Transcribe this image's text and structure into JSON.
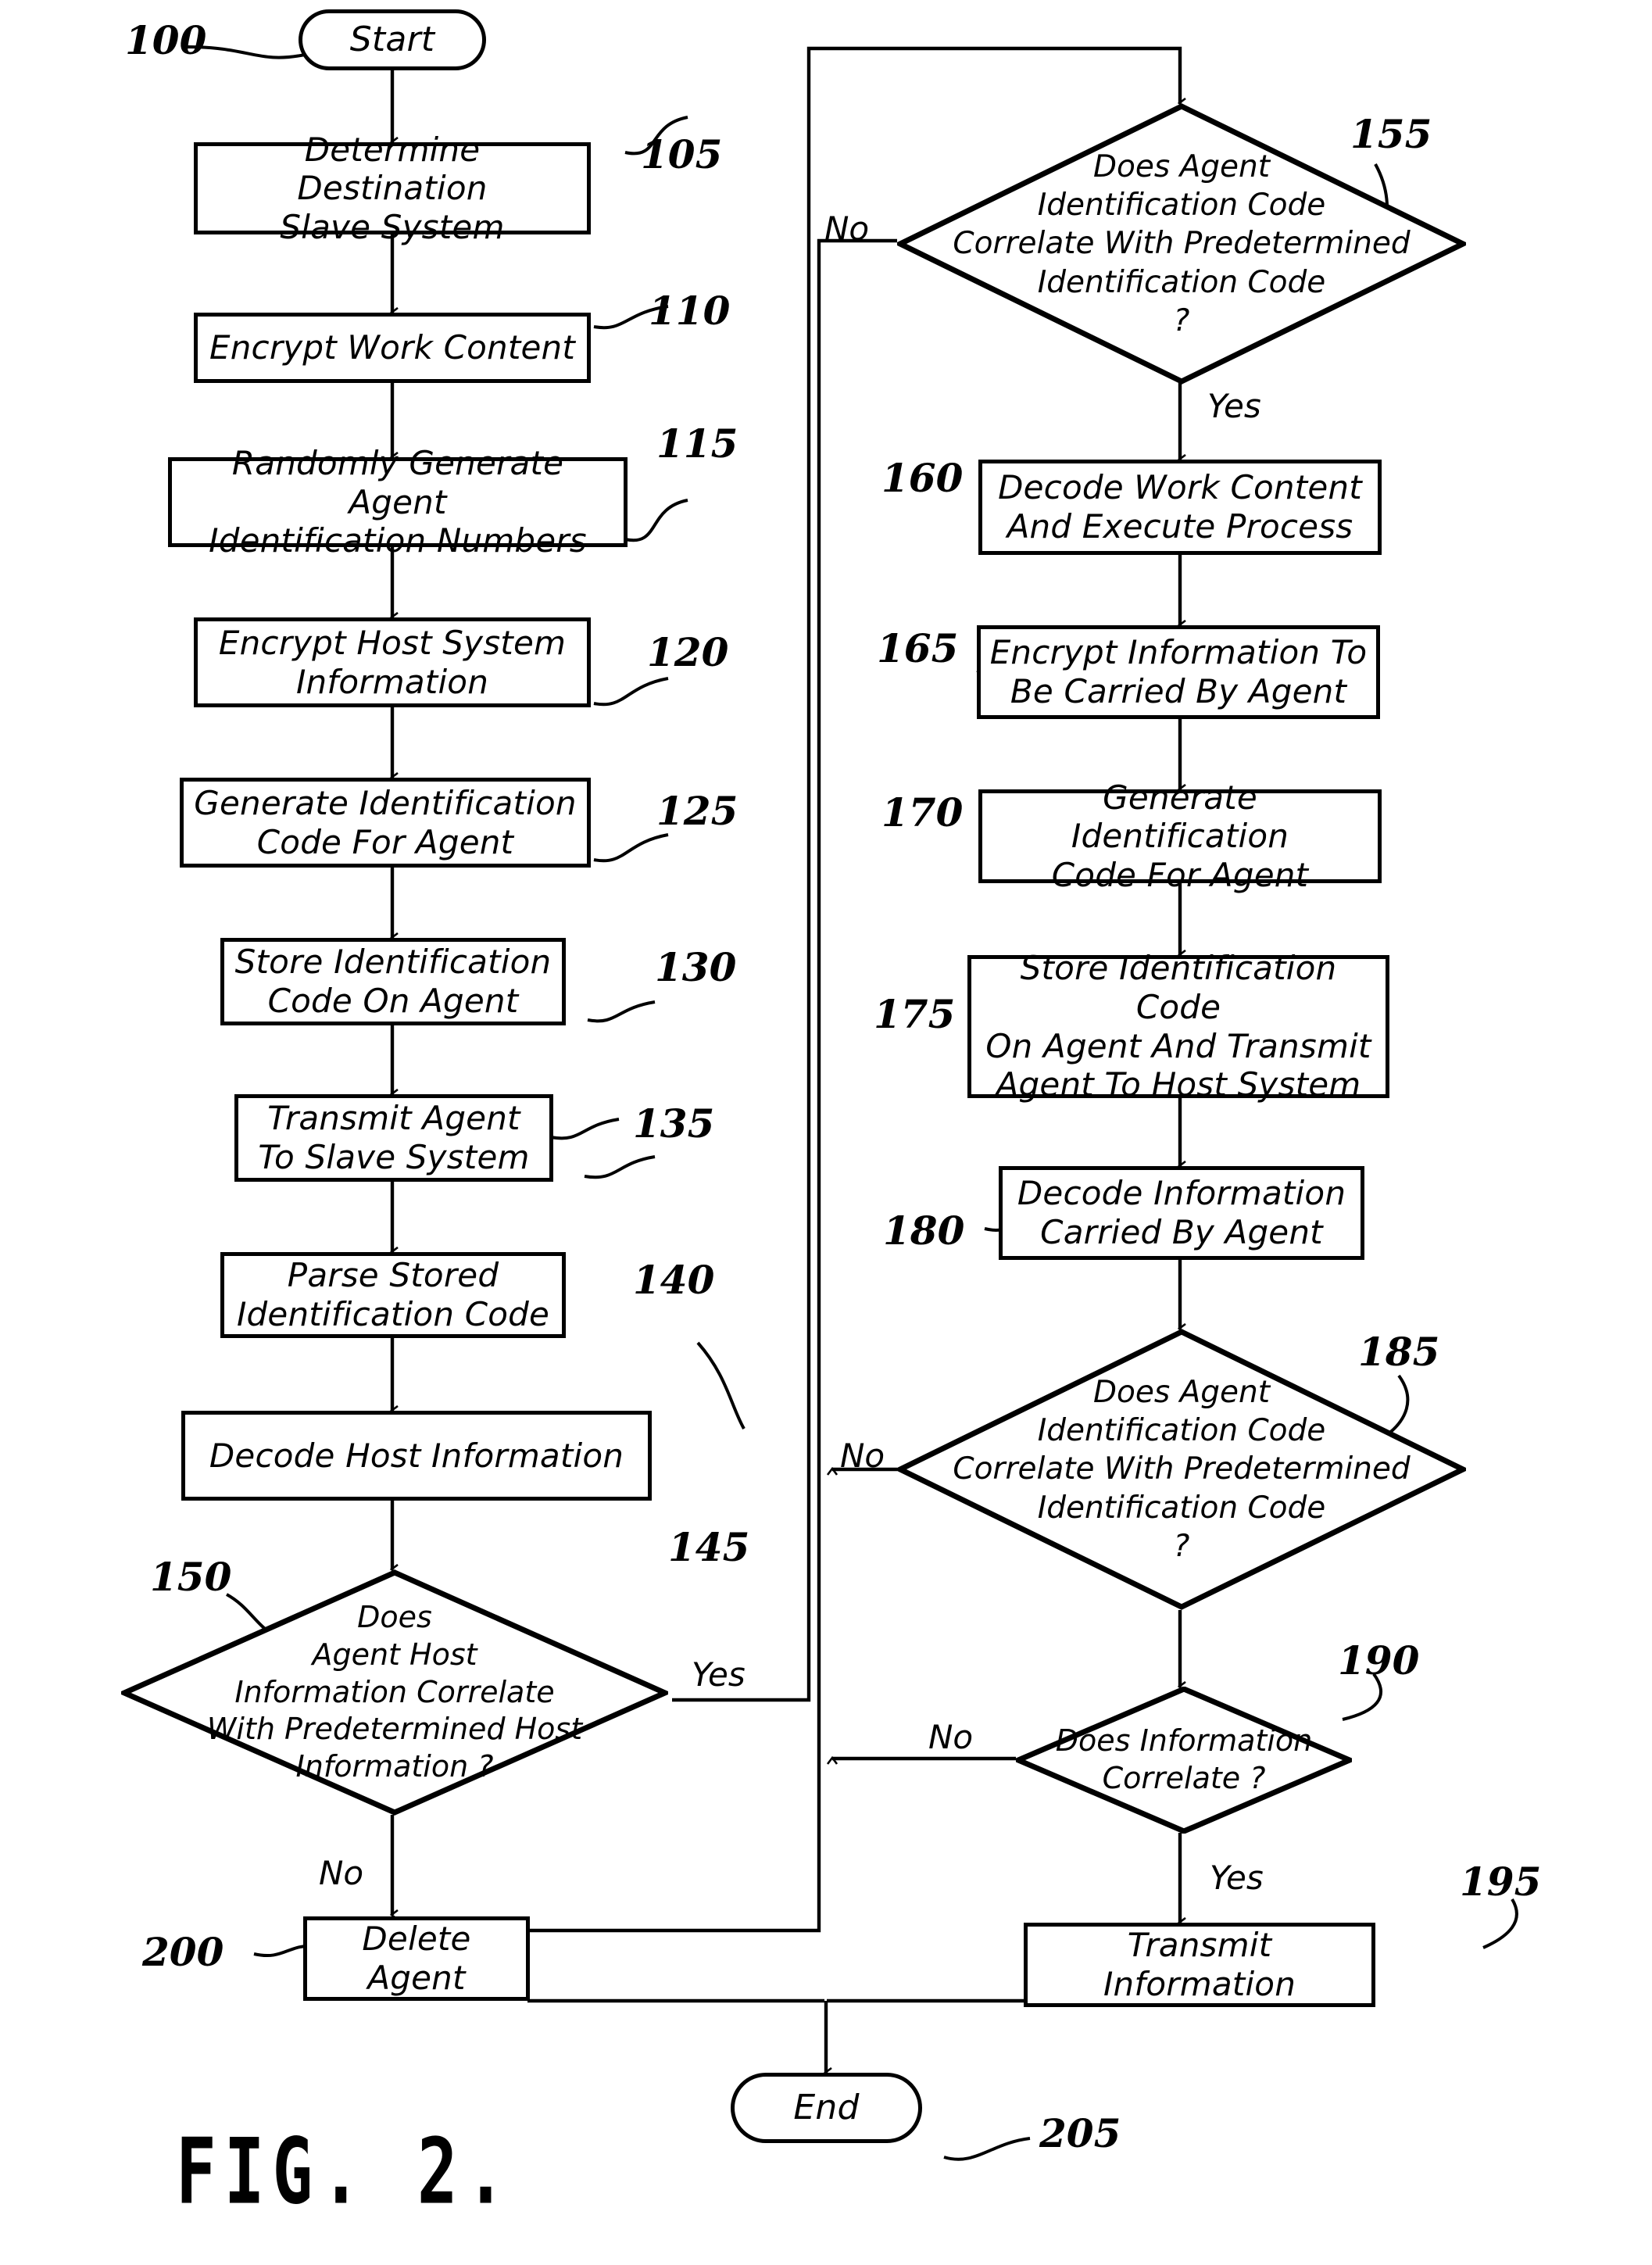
{
  "figure": {
    "label": "FIG. 2.",
    "ref_main": "100"
  },
  "terminals": [
    {
      "id": "start",
      "label": "Start",
      "ref": "100"
    },
    {
      "id": "end",
      "label": "End",
      "ref": "205"
    }
  ],
  "left_column": [
    {
      "ref": "105",
      "label": "Determine Destination\nSlave System"
    },
    {
      "ref": "110",
      "label": "Encrypt Work Content"
    },
    {
      "ref": "115",
      "label": "Randomly Generate Agent\nIdentification Numbers"
    },
    {
      "ref": "120",
      "label": "Encrypt Host System\nInformation"
    },
    {
      "ref": "125",
      "label": "Generate Identification\nCode For Agent"
    },
    {
      "ref": "130",
      "label": "Store Identification\nCode On Agent"
    },
    {
      "ref": "135",
      "label": "Transmit Agent\nTo Slave System"
    },
    {
      "ref": "140",
      "label": "Parse Stored\nIdentification Code"
    },
    {
      "ref": "145",
      "label": "Decode Host Information"
    }
  ],
  "right_column": [
    {
      "ref": "160",
      "label": "Decode Work Content\nAnd Execute Process"
    },
    {
      "ref": "165",
      "label": "Encrypt Information To\nBe Carried By Agent"
    },
    {
      "ref": "170",
      "label": "Generate Identification\nCode For Agent"
    },
    {
      "ref": "175",
      "label": "Store Identification Code\nOn Agent And Transmit\nAgent To Host System"
    },
    {
      "ref": "180",
      "label": "Decode Information\nCarried By Agent"
    }
  ],
  "decisions": [
    {
      "ref": "150",
      "label": "Does\nAgent Host\nInformation Correlate\nWith Predetermined Host\nInformation ?",
      "yes_label": "Yes",
      "no_label": "No"
    },
    {
      "ref": "155",
      "label": "Does Agent\nIdentification Code\nCorrelate With Predetermined\nIdentification Code\n?",
      "yes_label": "Yes",
      "no_label": "No"
    },
    {
      "ref": "185",
      "label": "Does Agent\nIdentification Code\nCorrelate With Predetermined\nIdentification Code\n?",
      "yes_label": "",
      "no_label": "No"
    },
    {
      "ref": "190",
      "label": "Does Information\nCorrelate ?",
      "yes_label": "Yes",
      "no_label": "No"
    }
  ],
  "outcomes": [
    {
      "ref": "195",
      "label": "Transmit Information"
    },
    {
      "ref": "200",
      "label": "Delete Agent"
    }
  ],
  "colors": {
    "ink": "#000000",
    "paper": "#ffffff"
  }
}
